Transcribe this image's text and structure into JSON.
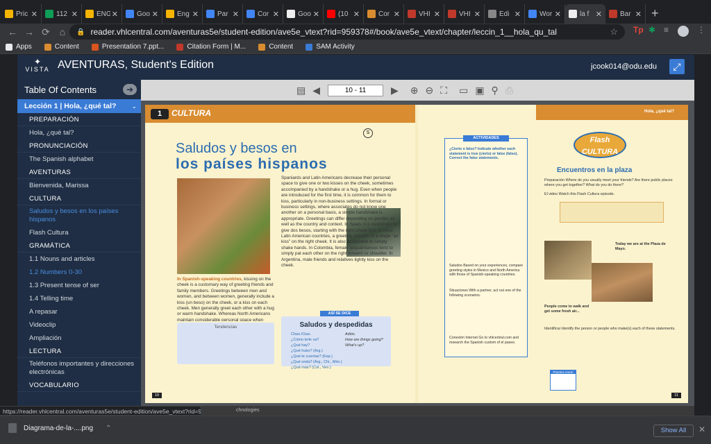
{
  "tabs": [
    {
      "label": "Pric",
      "color": "#f4b400"
    },
    {
      "label": "112",
      "color": "#0f9d58"
    },
    {
      "label": "ENG",
      "color": "#f4b400"
    },
    {
      "label": "Goo",
      "color": "#4285f4"
    },
    {
      "label": "Eng",
      "color": "#f4b400"
    },
    {
      "label": "Par",
      "color": "#4285f4"
    },
    {
      "label": "Cor",
      "color": "#4285f4"
    },
    {
      "label": "Goo",
      "color": "#eeeeee"
    },
    {
      "label": "(10",
      "color": "#ff0000"
    },
    {
      "label": "Cor",
      "color": "#d98c30"
    },
    {
      "label": "VHI",
      "color": "#c0392b"
    },
    {
      "label": "VHI",
      "color": "#c0392b"
    },
    {
      "label": "Edi",
      "color": "#888888"
    },
    {
      "label": "Wor",
      "color": "#4285f4"
    },
    {
      "label": "la f",
      "color": "#eeeeee"
    },
    {
      "label": "Bar",
      "color": "#c0392b"
    }
  ],
  "close_glyph": "✕",
  "new_tab": "+",
  "url": "reader.vhlcentral.com/aventuras5e/student-edition/ave5e_vtext?rid=959378#/book/ave5e_vtext/chapter/leccin_1__hola_qu_tal",
  "bookmarks": [
    {
      "label": "Apps",
      "color": "#e8eaed"
    },
    {
      "label": "Content",
      "color": "#d98c30"
    },
    {
      "label": "Presentation 7.ppt...",
      "color": "#d9541e"
    },
    {
      "label": "Citation Form | M...",
      "color": "#c0392b"
    },
    {
      "label": "Content",
      "color": "#d98c30"
    },
    {
      "label": "SAM Activity",
      "color": "#3a7bd5"
    }
  ],
  "header": {
    "logo_text": "VISTA",
    "title": "AVENTURAS, Student's Edition",
    "user": "jcook014@odu.edu"
  },
  "sidebar": {
    "title": "Table Of Contents",
    "lesson": "Lección 1 | Hola, ¿qué tal?",
    "rows": [
      {
        "type": "sec",
        "label": "PREPARACIÓN"
      },
      {
        "type": "item",
        "label": "Hola, ¿qué tal?"
      },
      {
        "type": "sec",
        "label": "PRONUNCIACIÓN"
      },
      {
        "type": "item",
        "label": "The Spanish alphabet"
      },
      {
        "type": "sec",
        "label": "AVENTURAS"
      },
      {
        "type": "item",
        "label": "Bienvenida, Marissa"
      },
      {
        "type": "sec",
        "label": "CULTURA"
      },
      {
        "type": "cur",
        "label": "Saludos y besos en los países hispanos"
      },
      {
        "type": "item",
        "label": "Flash Cultura"
      },
      {
        "type": "sec",
        "label": "GRAMÁTICA"
      },
      {
        "type": "item",
        "label": "1.1 Nouns and articles"
      },
      {
        "type": "dim",
        "label": "1.2 Numbers 0-30"
      },
      {
        "type": "item",
        "label": "1.3 Present tense of ser"
      },
      {
        "type": "item",
        "label": "1.4 Telling time"
      },
      {
        "type": "item",
        "label": "A repasar"
      },
      {
        "type": "item",
        "label": "Videoclip"
      },
      {
        "type": "item",
        "label": "Ampliación"
      },
      {
        "type": "sec",
        "label": "LECTURA"
      },
      {
        "type": "item",
        "label": "Teléfonos importantes y direcciones electrónicas"
      },
      {
        "type": "sec",
        "label": "VOCABULARIO"
      }
    ]
  },
  "viewer": {
    "page_value": "10 - 11"
  },
  "left_page": {
    "band_num": "1",
    "band_label": "CULTURA",
    "title_1": "Saludos y besos en",
    "title_2": "los países hispanos",
    "caption": "In Spanish-speaking countries,",
    "caption_rest": " kissing on the cheek is a customary way of greeting friends and family members. Greetings between men and women, and between women, generally include a kiss (un beso) on the cheek, or a kiss on each cheek. Men generally greet each other with a hug or warm handshake. Whereas North Americans maintain considerable personal space when greeting,",
    "body": "Spaniards and Latin Americans decrease their personal space to give one or two kisses on the cheek, sometimes accompanied by a handshake or a hug. Even when people are introduced for the first time, it is common for them to kiss, particularly in non-business settings. In formal or business settings, where associates do not know one another on a personal basis, a simple handshake is appropriate. Greetings can differ depending on gender, as well as the country and context. In Spain, it is customary to give dos besos, starting with the right cheek first. In most Latin American countries, a greeting consists of a single \"air kiss\" on the right cheek. It is also acceptable to simply shake hands. In Colombia, female acquaintances tend to simply pat each other on the right forearm or shoulder. In Argentina, male friends and relatives lightly kiss on the cheek.",
    "tendencias": "Tendencias",
    "asi_se_dice": "ASÍ SE DICE",
    "saludos_title": "Saludos y despedidas",
    "saludos_col1": "Chao./Ciao.\n¿Cómo te/le va?\n¿Qué hay?\n¿Qué hubo? (Arg.)\n¿Qué te cuentas? (Esp.)\n¿Qué onda? (Arg., Chi., Méx.)\n¿Qué más? (Col., Ven.)",
    "saludos_col2": "Adiós.\nHow are things going?\nWhat's up?",
    "page_num": "10"
  },
  "right_page": {
    "header": "Hola, ¿qué tal?",
    "actividades": "ACTIVIDADES",
    "act1": "¿Cierto o falso? Indicate whether each statement is true (cierto) or false (falso). Correct the false statements.",
    "act2": "Saludos Based on your experiences, compare greeting styles in Mexico and North America with those of Spanish-speaking countries.",
    "act3": "Situaciones With a partner, act out one of the following scenarios.",
    "act4": "Conexión Internet Go to vhlcentral.com and research the Spanish custom of el paseo.",
    "flash": "Flash CULTURA",
    "encuentros": "Encuentros en la plaza",
    "prep": "Preparación Where do you usually meet your friends? Are there public places where you get together? What do you do there?",
    "video": "El video Watch this Flash Cultura episode.",
    "plaza": "Today we are at the Plaza de Mayo.",
    "people": "People come to walk and get some fresh air...",
    "identificar": "Identificar Identify the person or people who make(s) each of these statements.",
    "practice": "Practice more!",
    "page_num": "11"
  },
  "status_url": "https://reader.vhlcentral.com/aventuras5e/student-edition/ave5e_vtext?rid=959...",
  "footer_text": "chnologies",
  "download": {
    "file": "Diagrama-de-la-....png",
    "show_all": "Show All"
  }
}
